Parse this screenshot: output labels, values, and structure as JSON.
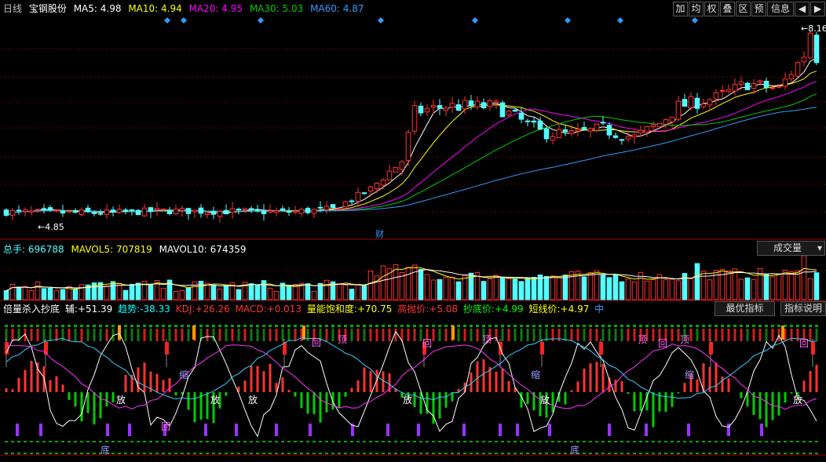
{
  "header": {
    "period": "日线",
    "stock": "宝钢股份",
    "ma": [
      {
        "label": "MA5:",
        "value": "4.98",
        "color": "#ffffff"
      },
      {
        "label": "MA10:",
        "value": "4.94",
        "color": "#ffff00"
      },
      {
        "label": "MA20:",
        "value": "4.95",
        "color": "#ff00ff"
      },
      {
        "label": "MA30:",
        "value": "5.03",
        "color": "#00cc00"
      },
      {
        "label": "MA60:",
        "value": "4.87",
        "color": "#3399ff"
      }
    ]
  },
  "toolbar": [
    "加",
    "均",
    "权",
    "叠",
    "区",
    "预",
    "信息",
    "◀",
    "▶"
  ],
  "price_labels": {
    "high": "8.16",
    "low": "4.85",
    "fin": "财"
  },
  "volume": {
    "total_label": "总手:",
    "total": "696788",
    "mavol5_label": "MAVOL5:",
    "mavol5": "707819",
    "mavol10_label": "MAVOL10:",
    "mavol10": "674359",
    "selector": "成交量"
  },
  "indicator": {
    "name": "倍量杀入抄底",
    "items": [
      {
        "label": "辅:",
        "value": "+51.39",
        "color": "#ffffff"
      },
      {
        "label": "趋势:",
        "value": "-38.33",
        "color": "#00ffff"
      },
      {
        "label": "KDJ:",
        "value": "+26.26",
        "color": "#ff3333"
      },
      {
        "label": "MACD:",
        "value": "+0.013",
        "color": "#ff3333"
      },
      {
        "label": "量能饱和度:",
        "value": "+70.75",
        "color": "#ffff00"
      },
      {
        "label": "高抛价:",
        "value": "+5.08",
        "color": "#ff3333"
      },
      {
        "label": "抄底价:",
        "value": "+4.99",
        "color": "#00ff00"
      },
      {
        "label": "短线价:",
        "value": "+4.97",
        "color": "#ffff00"
      },
      {
        "label": "中",
        "value": "",
        "color": "#3399ff"
      }
    ],
    "btn_best": "最优指标",
    "btn_help": "指标说明",
    "marks": [
      "回",
      "顶",
      "缩",
      "放",
      "底"
    ]
  },
  "chart_data": {
    "type": "candlestick",
    "count": 130,
    "price_high": 8.16,
    "price_low": 4.85,
    "colors": {
      "up": "#ff3232",
      "down": "#54ffff",
      "ma5": "#ffffff",
      "ma10": "#ffff00",
      "ma20": "#ff00ff",
      "ma30": "#00cc00",
      "ma60": "#3399ff"
    }
  }
}
